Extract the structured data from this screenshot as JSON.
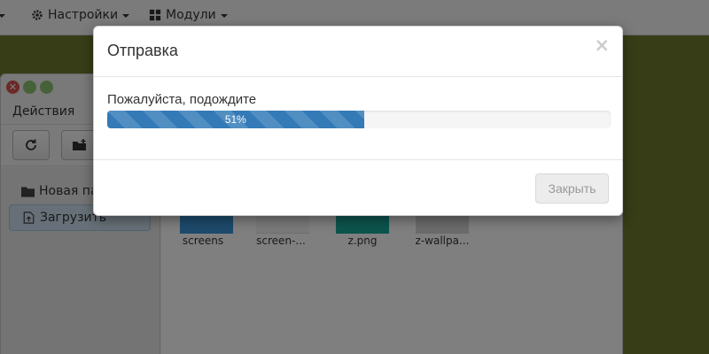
{
  "topbar": {
    "settings_label": "Настройки",
    "modules_label": "Модули",
    "settings_icon": "gear-icon",
    "modules_icon": "grid-icon"
  },
  "window": {
    "menu_label": "Действия",
    "toolbar": {
      "refresh_icon": "refresh-icon",
      "new_folder_icon": "folder-plus-icon"
    },
    "sidebar": {
      "items": [
        {
          "label": "Новая па",
          "icon": "folder-icon"
        },
        {
          "label": "Загрузить",
          "icon": "upload-file-icon"
        }
      ]
    },
    "files": [
      {
        "name": "screens"
      },
      {
        "name": "screen-..."
      },
      {
        "name": "z.png"
      },
      {
        "name": "z-wallpa..."
      }
    ]
  },
  "modal": {
    "title": "Отправка",
    "close_glyph": "×",
    "wait_text": "Пожалуйста, подождите",
    "progress": {
      "percent": 51,
      "label": "51%"
    },
    "close_button_label": "Закрыть"
  },
  "colors": {
    "progress_bar": "#337ab7",
    "background_desktop": "#6f7a2e"
  }
}
